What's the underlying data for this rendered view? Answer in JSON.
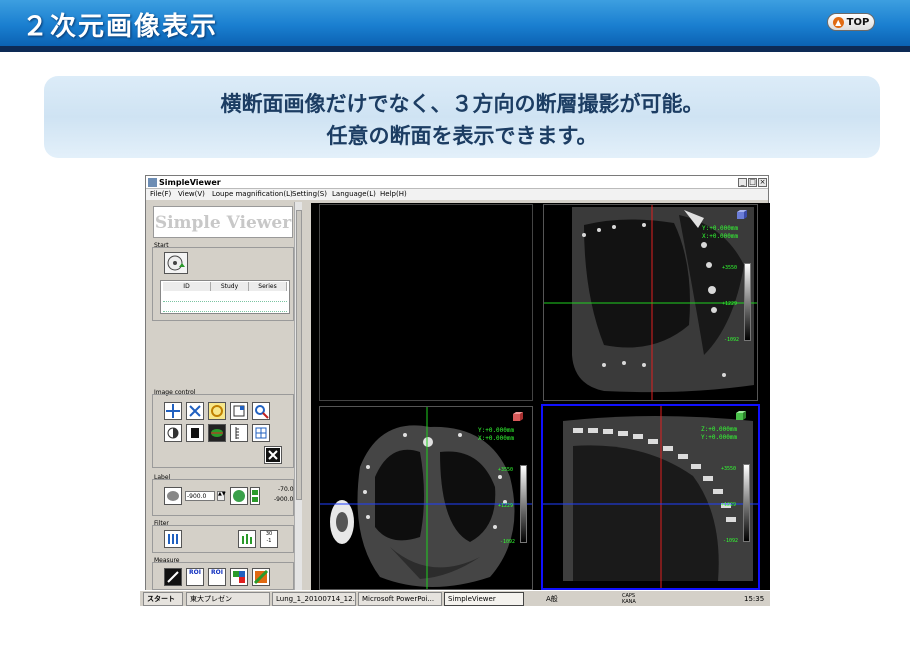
{
  "slide": {
    "title": "２次元画像表示",
    "top_button": "TOP",
    "caption_line1": "横断面画像だけでなく、３方向の断層撮影が可能。",
    "caption_line2": "任意の断面を表示できます。"
  },
  "window": {
    "title": "SimpleViewer",
    "menu": [
      "File(F)",
      "View(V)",
      "Loupe magnification(L)",
      "Setting(S)",
      "Language(L)",
      "Help(H)"
    ],
    "controls": [
      "_",
      "□",
      "×"
    ]
  },
  "left_panel": {
    "logo": "Simple Viewer",
    "start_label": "Start",
    "list_headers": [
      "ID",
      "Study",
      "Series"
    ],
    "image_control_label": "Image control",
    "label_label": "Label",
    "label_input_value": "-900.0",
    "label_range_high": "-70.0",
    "label_range_low": "-900.0",
    "filter_label": "Filter",
    "filter_button_text": "30\n-1",
    "measure_label": "Measure",
    "roi1": "ROI",
    "roi2": "ROI"
  },
  "panes": {
    "top_right": {
      "coord1": "Y:+0.000mm",
      "coord2": "X:+0.000mm",
      "wl_high": "+3550",
      "wl_mid": "+1229",
      "wl_low": "-1092"
    },
    "bottom_left": {
      "coord1": "Y:+0.000mm",
      "coord2": "X:+0.000mm",
      "wl_high": "+3550",
      "wl_mid": "+1229",
      "wl_low": "-1092"
    },
    "bottom_right": {
      "coord1": "Z:+0.000mm",
      "coord2": "Y:+0.000mm",
      "wl_high": "+3550",
      "wl_mid": "+1229",
      "wl_low": "-1092"
    }
  },
  "taskbar": {
    "start": "スタート",
    "items": [
      "東大プレゼン",
      "Lung_1_20100714_12...",
      "Microsoft PowerPoi...",
      "SimpleViewer"
    ],
    "ime": "A般",
    "tray_text": "CAPS\nKANA",
    "clock": "15:35"
  },
  "colors": {
    "header": "#1a7fd0",
    "caption_bg": "#d5e8f6",
    "crosshair_red": "#e02020",
    "crosshair_green": "#20d020",
    "crosshair_blue": "#2040ff",
    "active_border": "#1010ff"
  }
}
